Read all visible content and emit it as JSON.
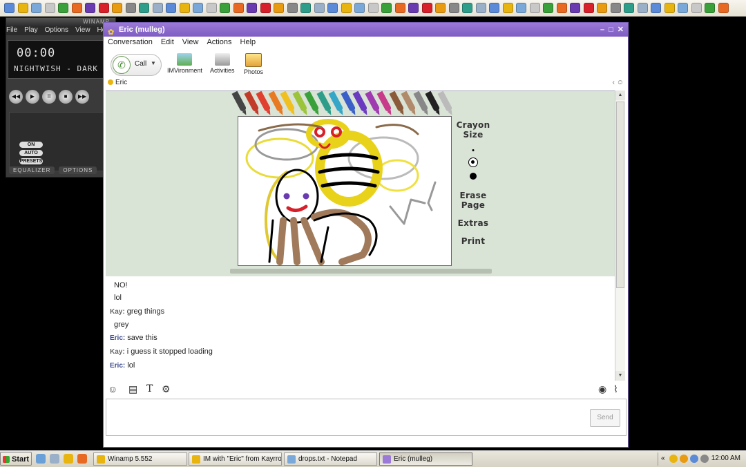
{
  "winamp": {
    "title": "WINAMP",
    "menu": [
      "File",
      "Play",
      "Options",
      "View",
      "He"
    ],
    "time": "00:00",
    "track": "NIGHTWISH - DARK",
    "buttons": [
      "◀◀",
      "▶",
      "II",
      "■",
      "▶▶"
    ],
    "eq_toggles": [
      "ON",
      "AUTO",
      "PRESETS"
    ],
    "tabs": [
      "EQUALIZER",
      "OPTIONS"
    ]
  },
  "messenger": {
    "title": "Eric (mulleg)",
    "menu": [
      "Conversation",
      "Edit",
      "View",
      "Actions",
      "Help"
    ],
    "toolbar": {
      "call": "Call",
      "imvironment": "IMVironment",
      "activities": "Activities",
      "photos": "Photos"
    },
    "buddy": "Eric",
    "draw_tools": {
      "crayon_size": "Crayon Size",
      "erase_page": "Erase Page",
      "extras": "Extras",
      "print": "Print"
    },
    "transcript": [
      {
        "speaker": "",
        "text": "NO!"
      },
      {
        "speaker": "",
        "text": "lol"
      },
      {
        "speaker": "Kay:",
        "text": "greg things"
      },
      {
        "speaker": "",
        "text": "grey"
      },
      {
        "speaker": "Eric:",
        "text": "save this"
      },
      {
        "speaker": "Kay:",
        "text": "i guess it stopped loading"
      },
      {
        "speaker": "Eric:",
        "text": "lol"
      }
    ],
    "send": "Send",
    "crayon_colors": [
      "#444444",
      "#c23a28",
      "#e04030",
      "#e87a22",
      "#f0c020",
      "#9bc43a",
      "#3aa03a",
      "#2e9e8a",
      "#34a6c8",
      "#3a5fc8",
      "#6a3ac0",
      "#a03ab0",
      "#c83a8a",
      "#8a5a3a",
      "#b08a6a",
      "#888888",
      "#222222",
      "#bbbbbb"
    ]
  },
  "taskbar": {
    "start": "Start",
    "tasks": [
      "Winamp 5.552",
      "IM with \"Eric\" from Kayrrot",
      "drops.txt - Notepad",
      "Eric (mulleg)"
    ],
    "clock": "12:00 AM"
  }
}
